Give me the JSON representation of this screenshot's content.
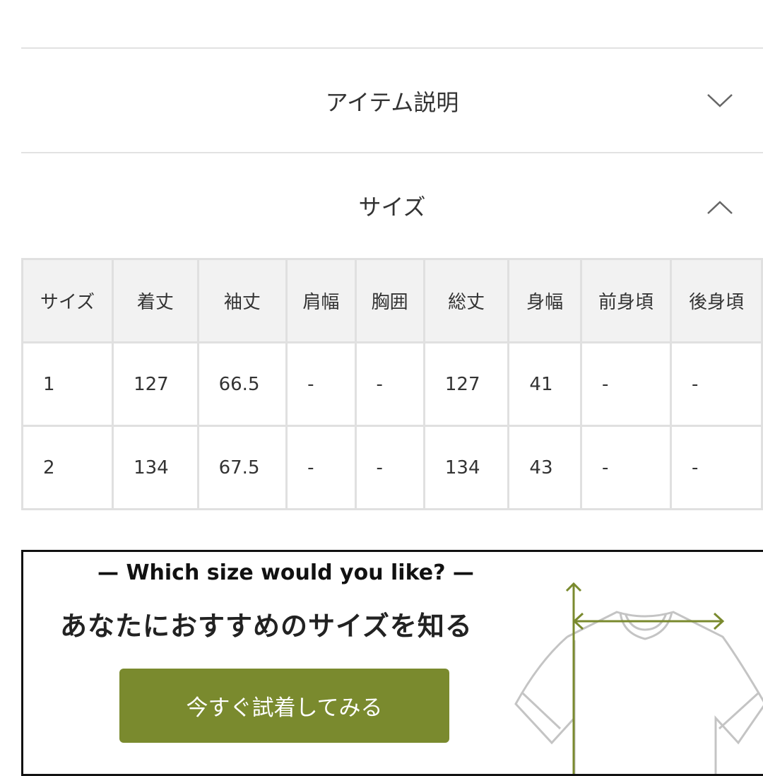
{
  "accordion": [
    {
      "label": "アイテム説明",
      "state": "collapsed",
      "icon": "chevron-down-icon"
    },
    {
      "label": "サイズ",
      "state": "expanded",
      "icon": "chevron-up-icon"
    }
  ],
  "size_table": {
    "headers": [
      "サイズ",
      "着丈",
      "袖丈",
      "肩幅",
      "胸囲",
      "総丈",
      "身幅",
      "前身頃",
      "後身頃"
    ],
    "rows": [
      [
        "1",
        "127",
        "66.5",
        "-",
        "-",
        "127",
        "41",
        "-",
        "-"
      ],
      [
        "2",
        "134",
        "67.5",
        "-",
        "-",
        "134",
        "43",
        "-",
        "-"
      ]
    ]
  },
  "banner": {
    "subtitle": "— Which size would you like? —",
    "title": "あなたにおすすめのサイズを知る",
    "button": "今すぐ試着してみる",
    "accent": "#7a8a2e"
  }
}
